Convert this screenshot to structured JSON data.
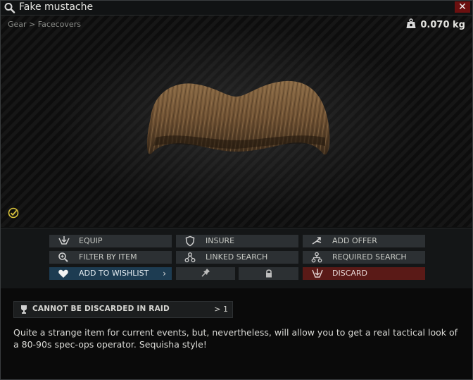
{
  "window": {
    "title": "Fake mustache",
    "close_label": "✕"
  },
  "preview": {
    "breadcrumb": "Gear > Facecovers",
    "weight": "0.070 kg"
  },
  "actions": {
    "equip": "EQUIP",
    "insure": "INSURE",
    "add_offer": "ADD OFFER",
    "filter_by_item": "FILTER BY ITEM",
    "linked_search": "LINKED SEARCH",
    "required_search": "REQUIRED SEARCH",
    "add_to_wishlist": "ADD TO WISHLIST",
    "wishlist_arrow": "›",
    "discard": "DISCARD"
  },
  "info": {
    "flag_label": "CANNOT BE DISCARDED IN RAID",
    "flag_count": "> 1",
    "description": "Quite a strange item for current events, but, nevertheless, will allow you to get a real tactical look of a 80-90s spec-ops operator. Sequisha style!"
  },
  "colors": {
    "accent_wishlist": "#1d3c52",
    "accent_discard": "#5a1a17",
    "close_button": "#6b1010",
    "check_icon": "#d8c23a"
  },
  "icons": [
    "search-icon",
    "close-icon",
    "weight-icon",
    "check-icon",
    "equip-icon",
    "insure-icon",
    "add-offer-icon",
    "filter-icon",
    "linked-search-icon",
    "required-search-icon",
    "heart-icon",
    "pin-icon",
    "lock-icon",
    "discard-icon",
    "trophy-icon"
  ]
}
